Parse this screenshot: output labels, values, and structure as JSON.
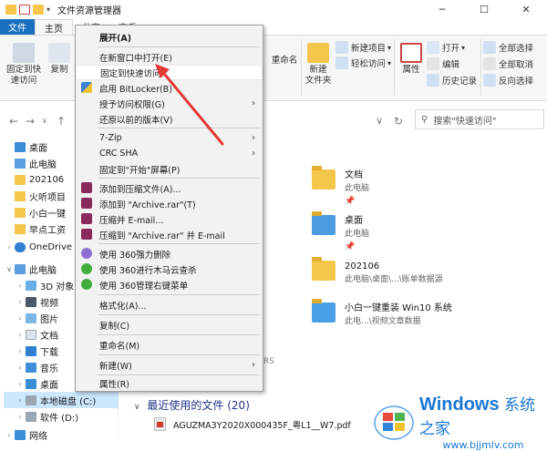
{
  "window": {
    "title": "文件资源管理器",
    "tab_share_partial": "共享",
    "tab_view_partial": "查看"
  },
  "tabs": {
    "file": "文件",
    "home": "主页"
  },
  "ribbon": {
    "pin_quick": "固定到快\n速访问",
    "copy": "复制",
    "rename": "重命名",
    "new_item": "新建项目",
    "easy_access": "轻松访问",
    "new_folder": "新建\n文件夹",
    "properties": "属性",
    "open": "打开",
    "edit": "编辑",
    "history": "历史记录",
    "select_all": "全部选择",
    "select_none": "全部取消",
    "invert_select": "反向选择"
  },
  "search": {
    "placeholder": "搜索\"快速访问\""
  },
  "nav": {
    "items": [
      "桌面",
      "此电脑",
      "202106",
      "火听项目",
      "小白一键",
      "早点工资",
      "OneDrive",
      "此电脑",
      "3D 对象",
      "视频",
      "图片",
      "文档",
      "下载",
      "音乐",
      "桌面",
      "本地磁盘 (C:)",
      "软件 (D:)",
      "网络"
    ]
  },
  "content": {
    "folders": [
      {
        "name": "文档",
        "sub": "此电脑"
      },
      {
        "name": "桌面",
        "sub": "此电脑"
      },
      {
        "name": "202106",
        "sub": "此电脑\\桌面\\...\\账单数据源"
      },
      {
        "name": "小白一键重装 Win10 系统",
        "sub": "此电...\\视频文章数据"
      }
    ],
    "recent_header": "最近使用的文件 (20)",
    "recent_file": "AGUZMA3Y2020X000435F_粤L1__W7.pdf",
    "stray_text": "RS"
  },
  "menu": {
    "items": [
      {
        "label": "展开(A)",
        "bold": true
      },
      {
        "label": "在新窗口中打开(E)"
      },
      {
        "label": "固定到快速访问"
      },
      {
        "label": "启用 BitLocker(B)"
      },
      {
        "label": "授予访问权限(G)",
        "submenu": true
      },
      {
        "label": "还原以前的版本(V)"
      },
      {
        "label": "7-Zip",
        "submenu": true
      },
      {
        "label": "CRC SHA",
        "submenu": true
      },
      {
        "label": "固定到\"开始\"屏幕(P)"
      },
      {
        "label": "添加到压缩文件(A)..."
      },
      {
        "label": "添加到 \"Archive.rar\"(T)"
      },
      {
        "label": "压缩并 E-mail..."
      },
      {
        "label": "压缩到 \"Archive.rar\" 并 E-mail"
      },
      {
        "label": "使用 360强力删除"
      },
      {
        "label": "使用 360进行木马云查杀"
      },
      {
        "label": "使用 360管理右键菜单"
      },
      {
        "label": "格式化(A)..."
      },
      {
        "label": "复制(C)"
      },
      {
        "label": "重命名(M)"
      },
      {
        "label": "新建(W)",
        "submenu": true
      },
      {
        "label": "属性(R)"
      }
    ]
  },
  "watermark": {
    "title_main": "Windows",
    "title_sub": "系统之家",
    "url": "www.bjjmlv.com"
  },
  "colors": {
    "accent": "#1a6fc1",
    "arrow": "#e53935",
    "folder": "#f4c64c"
  }
}
